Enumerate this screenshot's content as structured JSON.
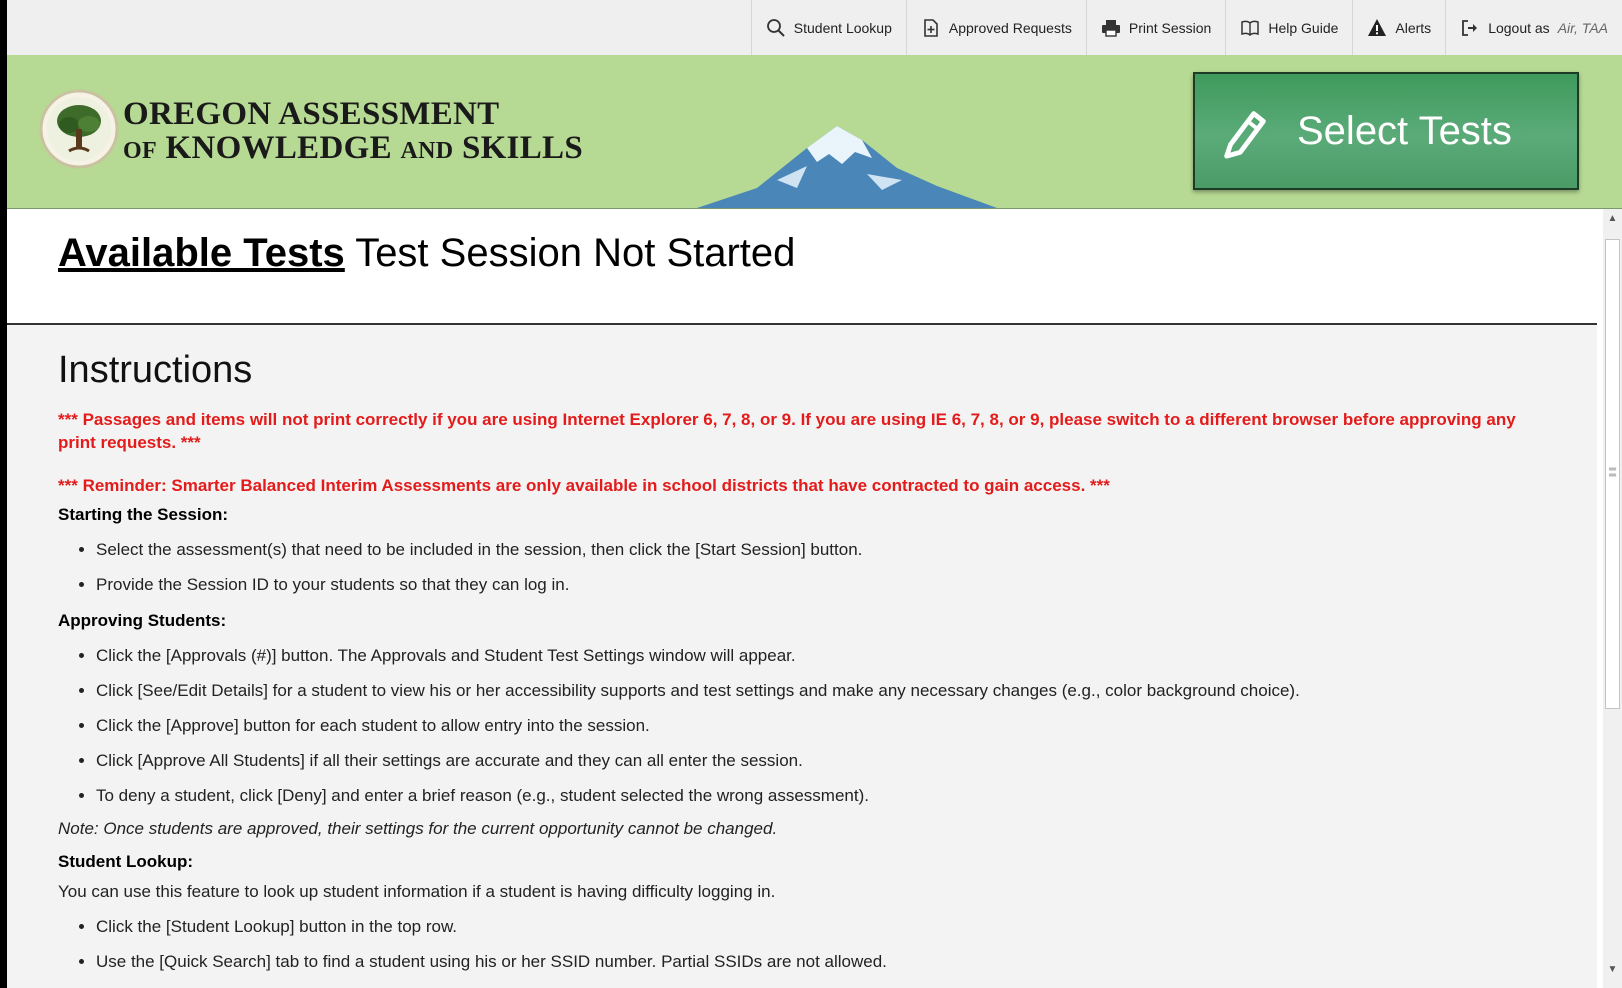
{
  "topnav": {
    "items": [
      {
        "label": "Student Lookup",
        "icon": "search-icon"
      },
      {
        "label": "Approved Requests",
        "icon": "document-add-icon"
      },
      {
        "label": "Print Session",
        "icon": "printer-icon"
      },
      {
        "label": "Help Guide",
        "icon": "book-icon"
      },
      {
        "label": "Alerts",
        "icon": "warning-icon"
      },
      {
        "label": "Logout as",
        "icon": "logout-icon"
      }
    ],
    "logout_user": "Air, TAA"
  },
  "banner": {
    "logo_line1": "Oregon Assessment",
    "logo_line2_of": "of",
    "logo_line2_rest": "Knowledge",
    "logo_line2_and": "and",
    "logo_line2_skills": "Skills",
    "select_tests_label": "Select Tests",
    "colors": {
      "banner": "#b6d993",
      "button": "#4b9b67"
    }
  },
  "page": {
    "title_link": "Available Tests",
    "title_status": "Test Session Not Started"
  },
  "instructions": {
    "heading": "Instructions",
    "warning1": "*** Passages and items will not print correctly if you are using Internet Explorer 6, 7, 8, or 9. If you are using IE 6, 7, 8, or 9, please switch to a different browser before approving any print requests. ***",
    "warning2": "*** Reminder: Smarter Balanced Interim Assessments are only available in school districts that have contracted to gain access. ***",
    "starting_heading": "Starting the Session:",
    "starting_items": [
      "Select the assessment(s) that need to be included in the session, then click the [Start Session] button.",
      "Provide the Session ID to your students so that they can log in."
    ],
    "approving_heading": "Approving Students:",
    "approving_items": [
      "Click the [Approvals (#)] button. The Approvals and Student Test Settings window will appear.",
      "Click [See/Edit Details] for a student to view his or her accessibility supports and test settings and make any necessary changes (e.g., color background choice).",
      "Click the [Approve] button for each student to allow entry into the session.",
      "Click [Approve All Students] if all their settings are accurate and they can all enter the session.",
      "To deny a student, click [Deny] and enter a brief reason (e.g., student selected the wrong assessment)."
    ],
    "note": "Note: Once students are approved, their settings for the current opportunity cannot be changed.",
    "lookup_heading": "Student Lookup:",
    "lookup_text": "You can use this feature to look up student information if a student is having difficulty logging in.",
    "lookup_items": [
      "Click the [Student Lookup] button in the top row.",
      "Use the [Quick Search] tab to find a student using his or her SSID number. Partial SSIDs are not allowed."
    ],
    "colors": {
      "warning": "#e31b1b"
    }
  }
}
